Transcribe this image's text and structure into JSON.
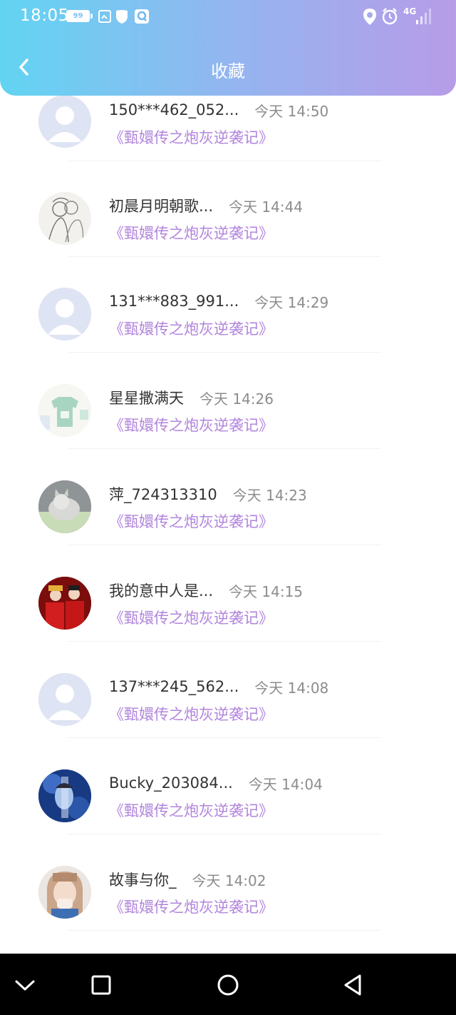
{
  "status_bar": {
    "time": "18:05",
    "battery": "99",
    "network": "4G",
    "icons": [
      "gallery-icon",
      "shield-icon",
      "q-app-icon",
      "location-icon",
      "alarm-icon",
      "signal-icon"
    ]
  },
  "header": {
    "title": "收藏",
    "back_icon": "chevron-left-icon"
  },
  "colors": {
    "header_gradient_start": "#62d4f2",
    "header_gradient_end": "#b79ce8",
    "username": "#333333",
    "timestamp": "#8c8c8c",
    "book_title": "#b184dc"
  },
  "favorites": [
    {
      "name": "150***462_052...",
      "time": "今天 14:50",
      "book": "《甄嬛传之炮灰逆袭记》",
      "avatar": "default"
    },
    {
      "name": "初晨月明朝歌...",
      "time": "今天 14:44",
      "book": "《甄嬛传之炮灰逆袭记》",
      "avatar": "sketch"
    },
    {
      "name": "131***883_991...",
      "time": "今天 14:29",
      "book": "《甄嬛传之炮灰逆袭记》",
      "avatar": "default"
    },
    {
      "name": "星星撒满天",
      "time": "今天 14:26",
      "book": "《甄嬛传之炮灰逆袭记》",
      "avatar": "tshirt"
    },
    {
      "name": "萍_724313310",
      "time": "今天 14:23",
      "book": "《甄嬛传之炮灰逆袭记》",
      "avatar": "cat"
    },
    {
      "name": "我的意中人是...",
      "time": "今天 14:15",
      "book": "《甄嬛传之炮灰逆袭记》",
      "avatar": "wedding"
    },
    {
      "name": "137***245_562...",
      "time": "今天 14:08",
      "book": "《甄嬛传之炮灰逆袭记》",
      "avatar": "default"
    },
    {
      "name": "Bucky_203084...",
      "time": "今天 14:04",
      "book": "《甄嬛传之炮灰逆袭记》",
      "avatar": "portrait"
    },
    {
      "name": "故事与你_",
      "time": "今天 14:02",
      "book": "《甄嬛传之炮灰逆袭记》",
      "avatar": "girl"
    }
  ],
  "nav_bar": {
    "buttons": [
      "hide-keyboard-icon",
      "recent-apps-icon",
      "home-icon",
      "back-triangle-icon"
    ]
  }
}
